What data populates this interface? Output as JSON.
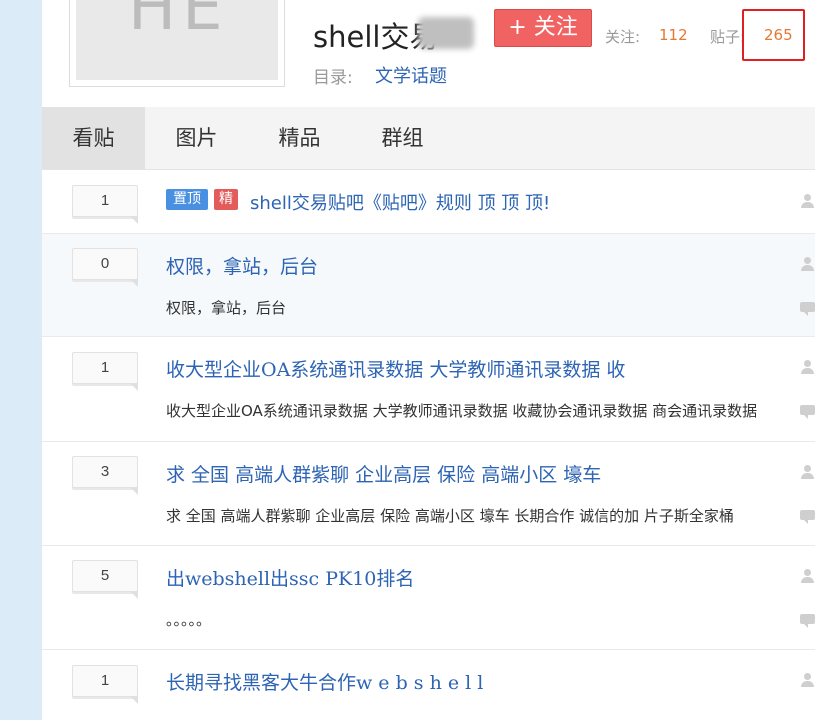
{
  "header": {
    "forum_name": "shell交易",
    "follow_button": "+ 关注",
    "stats": {
      "follow_label": "关注:",
      "follow_count": "112",
      "posts_label": "贴子:",
      "posts_count": "265"
    },
    "directory_label": "目录:",
    "directory_link": "文学话题"
  },
  "tabs": [
    "看贴",
    "图片",
    "精品",
    "群组"
  ],
  "badges": {
    "top": "置顶",
    "jing": "精"
  },
  "threads": [
    {
      "replies": "1",
      "title": "shell交易贴吧《贴吧》规则 顶 顶 顶!",
      "abstract": ""
    },
    {
      "replies": "0",
      "title": "权限，拿站，后台",
      "abstract": "权限，拿站，后台"
    },
    {
      "replies": "1",
      "title": "收大型企业OA系统通讯录数据 大学教师通讯录数据 收",
      "abstract": "收大型企业OA系统通讯录数据 大学教师通讯录数据 收藏协会通讯录数据 商会通讯录数据"
    },
    {
      "replies": "3",
      "title": "求 全国 高端人群紫聊 企业高层 保险 高端小区 壕车",
      "abstract": "求 全国 高端人群紫聊 企业高层 保险 高端小区 壕车 长期合作 诚信的加 片子斯全家桶"
    },
    {
      "replies": "5",
      "title": "出webshell出ssc PK10排名",
      "abstract": "。。。。。"
    },
    {
      "replies": "1",
      "title": "长期寻找黑客大牛合作w e b s h e l l",
      "abstract": ""
    }
  ],
  "icons": {
    "user": "user-icon",
    "comment": "comment-icon"
  }
}
